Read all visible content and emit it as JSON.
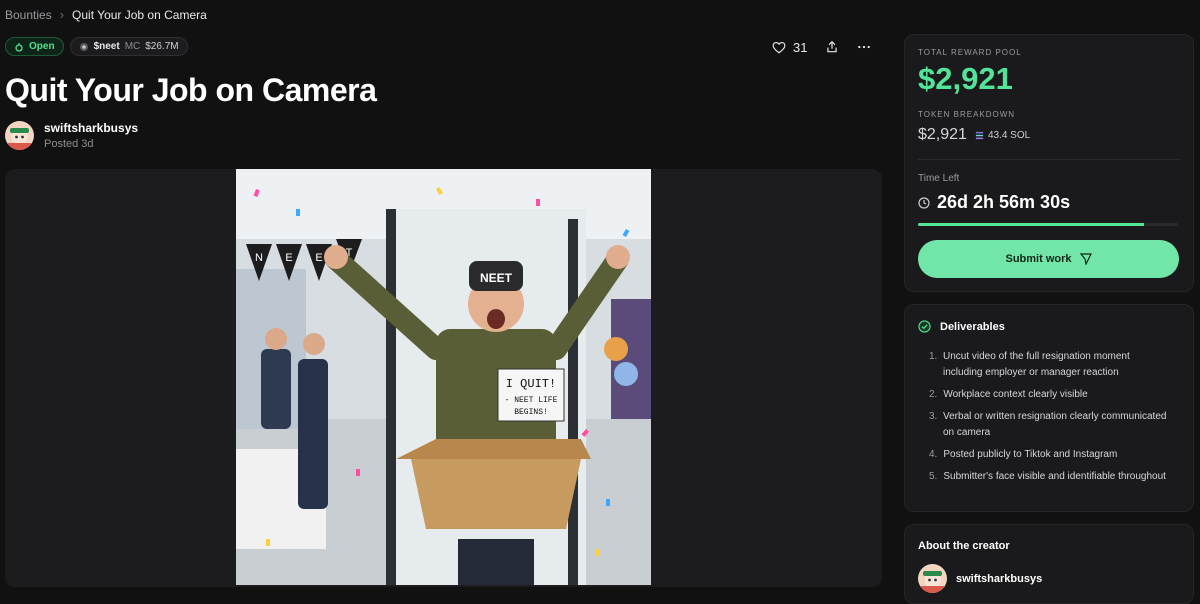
{
  "breadcrumb": {
    "root": "Bounties",
    "separator": "›",
    "current": "Quit Your Job on Camera"
  },
  "status": {
    "label": "Open",
    "color": "#51e08f"
  },
  "token_badge": {
    "symbol": "$neet",
    "mc_label": "MC",
    "mc_value": "$26.7M"
  },
  "actions": {
    "likes": "31",
    "like_icon": "heart-icon",
    "share_icon": "share-icon",
    "more_icon": "more-icon"
  },
  "bounty": {
    "title": "Quit Your Job on Camera",
    "author": "swiftsharkbusys",
    "posted": "Posted 3d"
  },
  "media": {
    "banner_letters": [
      "N",
      "E",
      "E",
      "T"
    ],
    "hat_text": "NEET",
    "sign_text": [
      "I QUIT!",
      "- NEET LIFE",
      "BEGINS!"
    ]
  },
  "reward": {
    "pool_label": "TOTAL REWARD POOL",
    "pool_amount": "$2,921",
    "breakdown_label": "TOKEN BREAKDOWN",
    "breakdown_usd": "$2,921",
    "breakdown_sol": "43.4 SOL",
    "time_left_label": "Time Left",
    "countdown": "26d 2h 56m 30s",
    "progress_percent": 87,
    "submit_label": "Submit work",
    "accent_color": "#53e49a"
  },
  "deliverables": {
    "title": "Deliverables",
    "items": [
      {
        "num": "1.",
        "text": "Uncut video of the full resignation moment including employer or manager reaction"
      },
      {
        "num": "2.",
        "text": "Workplace context clearly visible"
      },
      {
        "num": "3.",
        "text": "Verbal or written resignation clearly communicated on camera"
      },
      {
        "num": "4.",
        "text": "Posted publicly to Tiktok and Instagram"
      },
      {
        "num": "5.",
        "text": "Submitter's face visible and identifiable throughout"
      }
    ]
  },
  "creator": {
    "title": "About the creator",
    "name": "swiftsharkbusys"
  }
}
